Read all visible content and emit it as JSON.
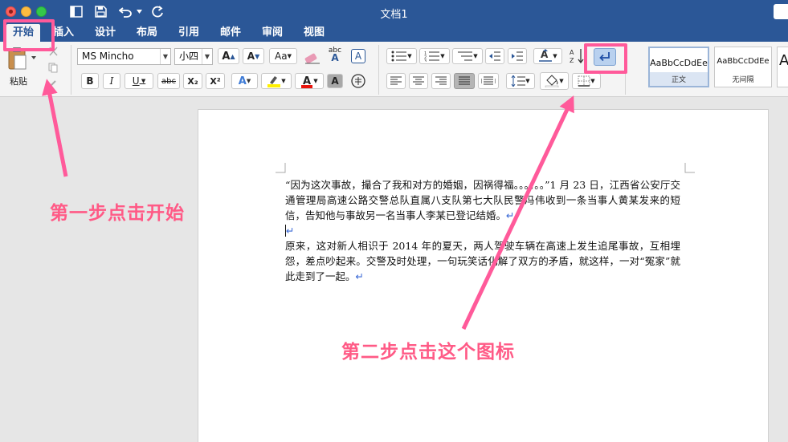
{
  "window": {
    "title": "文档1"
  },
  "quick_access": {
    "sidebar_icon": "sidebar-icon",
    "save_icon": "save-icon",
    "undo_icon": "undo-icon",
    "redo_icon": "redo-icon"
  },
  "tabs": [
    {
      "label": "开始",
      "active": true
    },
    {
      "label": "插入"
    },
    {
      "label": "设计"
    },
    {
      "label": "布局"
    },
    {
      "label": "引用"
    },
    {
      "label": "邮件"
    },
    {
      "label": "审阅"
    },
    {
      "label": "视图"
    }
  ],
  "ribbon": {
    "paste_label": "粘贴",
    "font_name": "MS Mincho",
    "font_size": "小四",
    "bold": "B",
    "italic": "I",
    "underline": "U",
    "strike": "abc",
    "subscript": "X₂",
    "superscript": "X²",
    "char_border": "A",
    "change_case": "Aa",
    "phonetic_guide": "abc",
    "styles": [
      {
        "sample": "AaBbCcDdEe",
        "name": "正文"
      },
      {
        "sample": "AaBbCcDdEe",
        "name": "无间隔"
      },
      {
        "sample": "A",
        "name": ""
      }
    ]
  },
  "document": {
    "paragraphs": [
      "“因为这次事故，撮合了我和对方的婚姻，因祸得福。。。。。。”1 月 23 日，江西省公安厅交通管理局高速公路交警总队直属八支队第七大队民警冯伟收到一条当事人黄某发来的短信，告知他与事故另一名当事人李某已登记结婚。",
      "",
      "原来，这对新人相识于 2014 年的夏天，两人驾驶车辆在高速上发生追尾事故，互相埋怨，差点吵起来。交警及时处理，一句玩笑话化解了双方的矛盾，就这样，一对“冤家”就此走到了一起。"
    ],
    "paragraph_mark": "↵"
  },
  "annotations": {
    "step1": "第一步点击开始",
    "step2": "第二步点击这个图标"
  },
  "colors": {
    "title_bar": "#2b5797",
    "annotation": "#ff5a86",
    "paragraph_mark": "#3b6ad6"
  }
}
